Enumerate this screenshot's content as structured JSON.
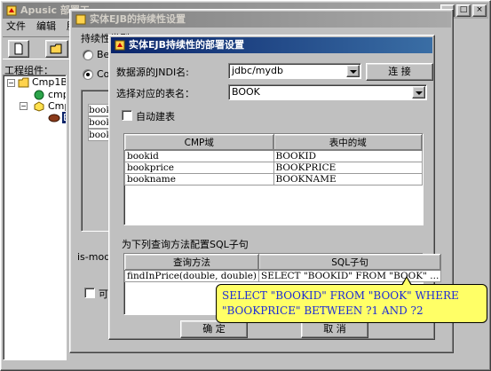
{
  "main_window": {
    "title": "Apusic 部署工",
    "menu": [
      "文件",
      "编辑",
      "服"
    ],
    "project_label": "工程组件：",
    "tree": [
      "Cmp1Bo",
      "cmp",
      "Cmp",
      "E"
    ]
  },
  "mid_dialog": {
    "title": "实体EJB的持续性设置",
    "section_label": "持续性类型",
    "radio_bean": "Bea",
    "radio_cmp": "Con",
    "list_rows": [
      "booki",
      "booki",
      "bookp"
    ],
    "is_modified_label": "is-modif",
    "reentrant_label": "可重"
  },
  "deploy_dialog": {
    "title": "实体EJB持续性的部署设置",
    "jndi_label": "数据源的JNDI名:",
    "jndi_value": "jdbc/mydb",
    "connect_button": "连 接",
    "table_label": "选择对应的表名：",
    "table_value": "BOOK",
    "auto_create_label": "自动建表",
    "cmp_table": {
      "headers": [
        "CMP域",
        "表中的域"
      ],
      "rows": [
        [
          "bookid",
          "BOOKID"
        ],
        [
          "bookprice",
          "BOOKPRICE"
        ],
        [
          "bookname",
          "BOOKNAME"
        ]
      ]
    },
    "sql_section_label": "为下列查询方法配置SQL子句",
    "sql_table": {
      "headers": [
        "查询方法",
        "SQL子句"
      ],
      "rows": [
        [
          "findInPrice(double, double)",
          "SELECT \"BOOKID\" FROM \"BOOK\" ..."
        ]
      ]
    },
    "ok_button": "确 定",
    "cancel_button": "取 消",
    "tooltip_text": "SELECT \"BOOKID\" FROM \"BOOK\" WHERE \"BOOKPRICE\" BETWEEN ?1 AND ?2"
  },
  "colors": {
    "title_active": "#0a246a",
    "tooltip_bg": "#ffff66",
    "tooltip_text": "#1d2bd6"
  },
  "icons": [
    "app-icon",
    "minimize-icon",
    "maximize-icon",
    "close-icon",
    "new-file-icon",
    "open-folder-icon",
    "tree-folder-icon",
    "component-icon",
    "bean-icon"
  ]
}
